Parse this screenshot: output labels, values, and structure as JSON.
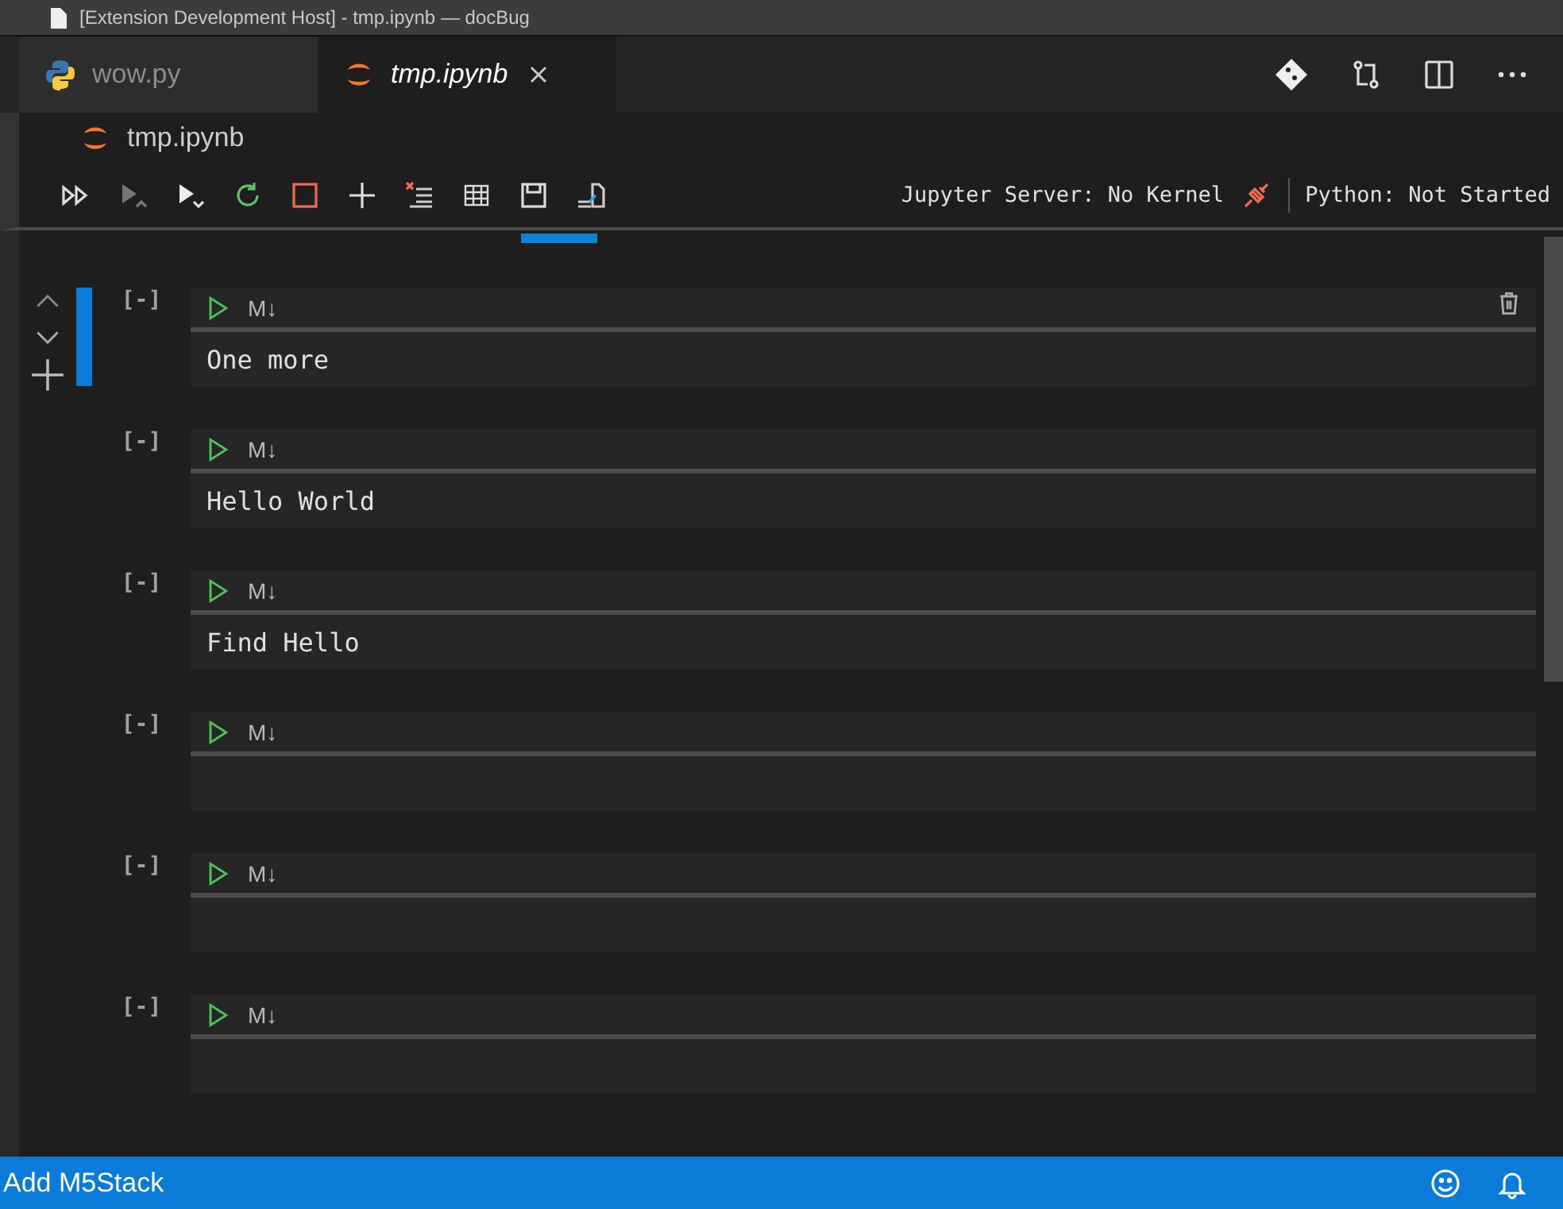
{
  "window": {
    "title": "[Extension Development Host] - tmp.ipynb — docBug"
  },
  "tabs": [
    {
      "label": "wow.py",
      "kind": "python",
      "selected": false
    },
    {
      "label": "tmp.ipynb",
      "kind": "jupyter",
      "selected": true
    }
  ],
  "breadcrumb": {
    "label": "tmp.ipynb"
  },
  "toolbar": {
    "server_status": "Jupyter Server: No Kernel",
    "kernel_status": "Python: Not Started",
    "busy": true
  },
  "cells": [
    {
      "prompt": "[-]",
      "type_label": "M↓",
      "text": "One more",
      "selected": true
    },
    {
      "prompt": "[-]",
      "type_label": "M↓",
      "text": "Hello World",
      "selected": false
    },
    {
      "prompt": "[-]",
      "type_label": "M↓",
      "text": "Find Hello",
      "selected": false
    },
    {
      "prompt": "[-]",
      "type_label": "M↓",
      "selected": false
    },
    {
      "prompt": "[-]",
      "type_label": "M↓",
      "selected": false
    },
    {
      "prompt": "[-]",
      "type_label": "M↓",
      "selected": false
    }
  ],
  "status_bar": {
    "left": "Add M5Stack"
  }
}
